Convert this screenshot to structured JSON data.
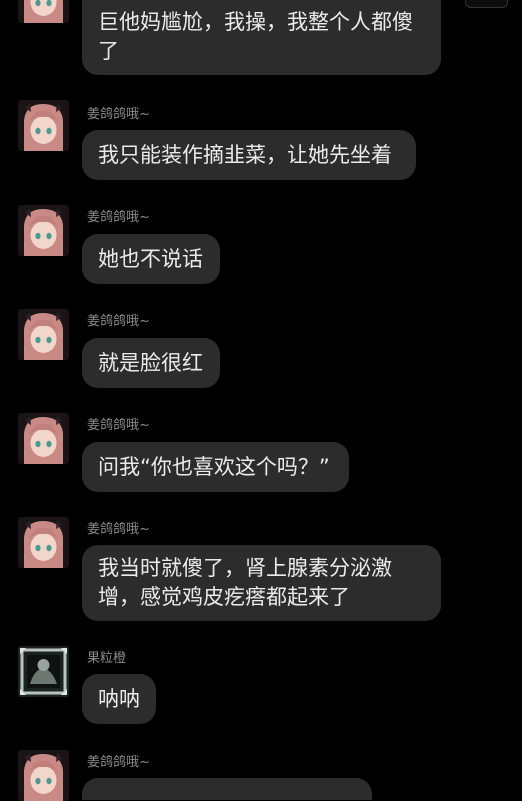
{
  "messages": [
    {
      "sender": "",
      "text": "巨他妈尴尬，我操，我整个人都傻了",
      "avatar": "anime-girl-avatar"
    },
    {
      "sender": "姜鸽鸽哦~",
      "text": "我只能装作摘韭菜，让她先坐着",
      "avatar": "anime-girl-avatar"
    },
    {
      "sender": "姜鸽鸽哦~",
      "text": "她也不说话",
      "avatar": "anime-girl-avatar"
    },
    {
      "sender": "姜鸽鸽哦~",
      "text": "就是脸很红",
      "avatar": "anime-girl-avatar"
    },
    {
      "sender": "姜鸽鸽哦~",
      "text": "问我“你也喜欢这个吗？”",
      "avatar": "anime-girl-avatar"
    },
    {
      "sender": "姜鸽鸽哦~",
      "text": "我当时就傻了，肾上腺素分泌激增，感觉鸡皮疙瘩都起来了",
      "avatar": "anime-girl-avatar"
    },
    {
      "sender": "果粒橙",
      "text": "呐呐",
      "avatar": "dark-framed-avatar"
    },
    {
      "sender": "姜鸽鸽哦~",
      "text": "",
      "avatar": "anime-girl-avatar"
    }
  ],
  "colors": {
    "background": "#000000",
    "bubble": "#2c2c2c",
    "bubble_text": "#ebebeb",
    "sender_text": "#8b8b8b"
  }
}
